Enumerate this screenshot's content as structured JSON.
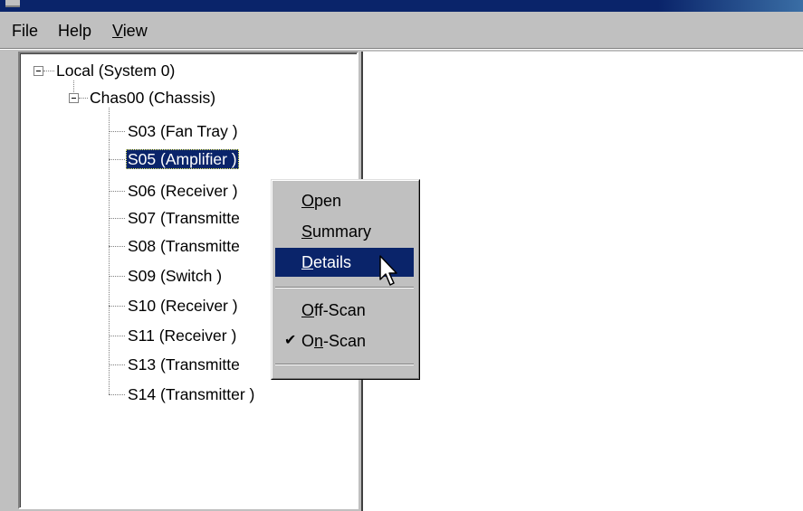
{
  "menubar": {
    "file": {
      "pre": "File",
      "ul": "",
      "post": ""
    },
    "help": {
      "pre": "Help",
      "ul": "",
      "post": ""
    },
    "view": {
      "pre": "",
      "ul": "V",
      "post": "iew"
    }
  },
  "tree": {
    "root": "Local (System 0)",
    "chassis": "Chas00 (Chassis)",
    "slots": [
      "S03 (Fan Tray )",
      "S05 (Amplifier )",
      "S06 (Receiver )",
      "S07 (Transmitte",
      "S08 (Transmitte",
      "S09 (Switch )",
      "S10 (Receiver )",
      "S11 (Receiver )",
      "S13 (Transmitte",
      "S14 (Transmitter )"
    ],
    "selected_index": 1
  },
  "context_menu": {
    "items": [
      {
        "ul": "O",
        "rest": "pen"
      },
      {
        "ul": "S",
        "rest": "ummary"
      },
      {
        "ul": "D",
        "rest": "etails"
      },
      {
        "ul": "O",
        "rest": "ff-Scan"
      },
      {
        "pre": "O",
        "ul": "n",
        "rest": "-Scan"
      }
    ],
    "highlighted": "Details",
    "checked": "On-Scan"
  },
  "icons": {
    "cursor": "arrow-cursor-icon",
    "check": "checkmark-icon",
    "collapse": "tree-collapse-icon"
  },
  "colors": {
    "selection": "#0a246a",
    "face": "#c0c0c0"
  }
}
